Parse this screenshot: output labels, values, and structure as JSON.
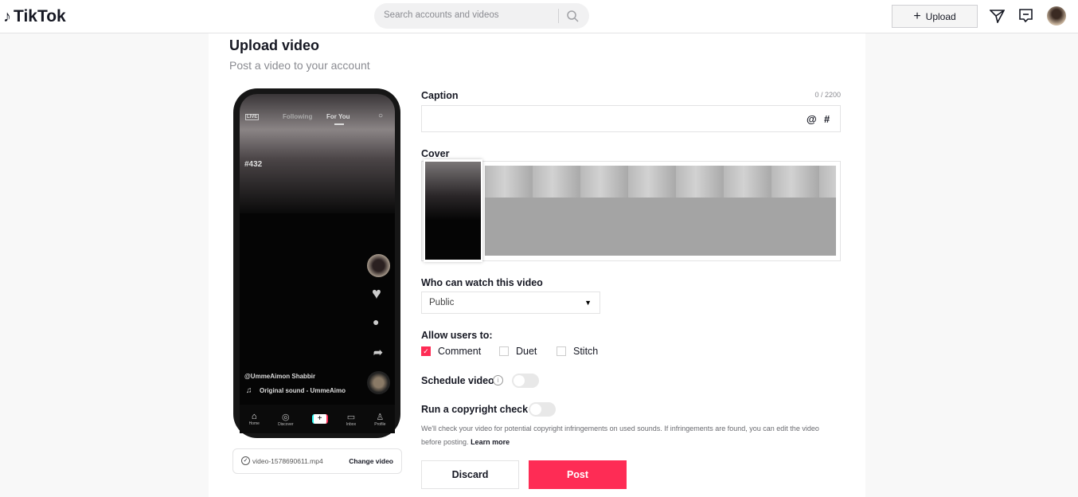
{
  "header": {
    "logo": "TikTok",
    "search_placeholder": "Search accounts and videos",
    "upload_label": "Upload"
  },
  "page": {
    "title": "Upload video",
    "subtitle": "Post a video to your account"
  },
  "preview": {
    "tabs": [
      "Following",
      "For You"
    ],
    "live": "LIVE",
    "tag": "#432",
    "username": "@UmmeAimon Shabbir",
    "sound": "Original sound - UmmeAimo",
    "nav": [
      "Home",
      "Discover",
      "",
      "Inbox",
      "Profile"
    ]
  },
  "file": {
    "name": "video-1578690611.mp4",
    "change_label": "Change video"
  },
  "caption": {
    "label": "Caption",
    "counter": "0 / 2200",
    "value": "",
    "mention": "@",
    "hashtag": "#"
  },
  "cover": {
    "label": "Cover"
  },
  "privacy": {
    "label": "Who can watch this video",
    "value": "Public"
  },
  "allow": {
    "label": "Allow users to:",
    "options": [
      {
        "label": "Comment",
        "checked": true
      },
      {
        "label": "Duet",
        "checked": false
      },
      {
        "label": "Stitch",
        "checked": false
      }
    ]
  },
  "schedule": {
    "label": "Schedule video",
    "enabled": false
  },
  "copyright": {
    "label": "Run a copyright check",
    "enabled": false,
    "note": "We'll check your video for potential copyright infringements on used sounds. If infringements are found, you can edit the video",
    "note2": "before posting.",
    "learn_more": "Learn more"
  },
  "actions": {
    "discard": "Discard",
    "post": "Post"
  },
  "colors": {
    "accent": "#fe2c55"
  }
}
